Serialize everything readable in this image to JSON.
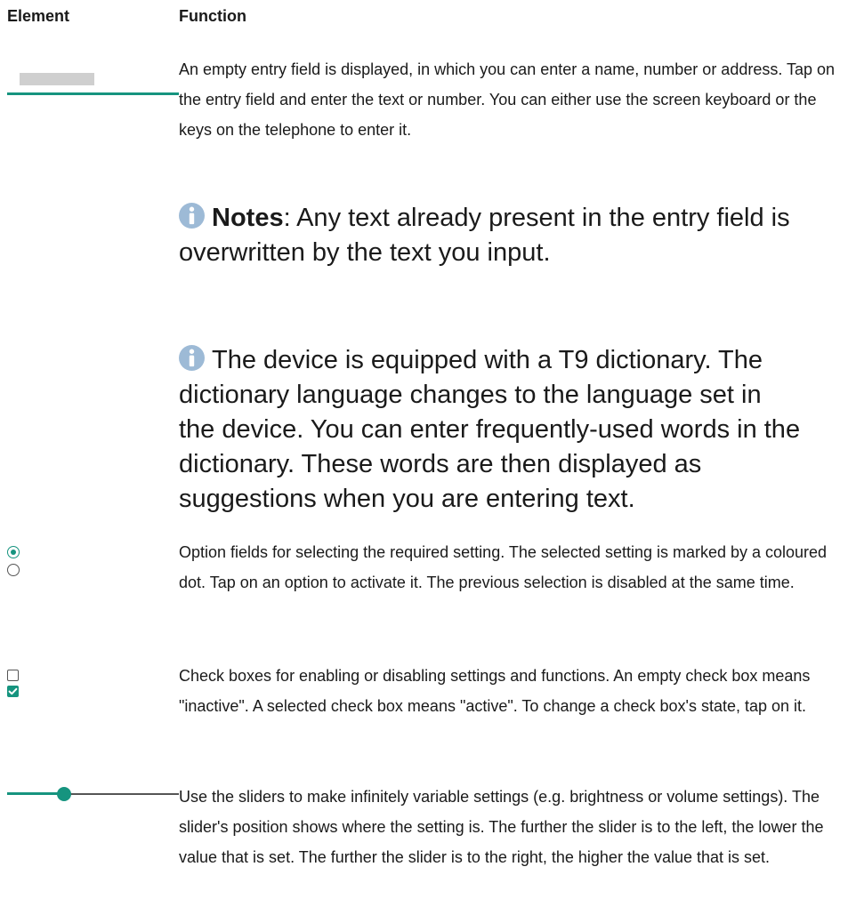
{
  "headers": {
    "element": "Element",
    "function": "Function"
  },
  "colors": {
    "accent": "#16947f",
    "field_fill": "#cfcfcf",
    "track": "#555555",
    "note_icon": "#9dbad6"
  },
  "rows": {
    "entry_field": {
      "description": "An empty entry field is displayed, in which you can enter a name, number or address. Tap on the entry field and enter the text or number. You can either use the screen keyboard or the keys on the telephone to enter it.",
      "notes": [
        {
          "icon": "info-icon",
          "label": "Notes",
          "text": ": Any text already present in the entry field is overwritten by the text you input."
        },
        {
          "icon": "info-icon",
          "text": "The device is equipped with a T9 dictionary. The dictionary language changes to the language set in the device. You can enter frequently-used words in the dictionary. These words are then displayed as suggestions when you are entering text."
        }
      ]
    },
    "option_fields": {
      "description": "Option fields for selecting the required setting. The selected setting is marked by a coloured dot. Tap on an option to activate it. The previous selection is disabled at the same time.",
      "options": [
        {
          "selected": true
        },
        {
          "selected": false
        }
      ]
    },
    "check_boxes": {
      "description": "Check boxes for enabling or disabling settings and functions. An empty check box means \"inactive\". A selected check box means \"active\". To change a check box's state, tap on it.",
      "boxes": [
        {
          "checked": false
        },
        {
          "checked": true
        }
      ]
    },
    "slider": {
      "description": "Use the sliders to make infinitely variable settings (e.g. brightness or volume settings). The slider's position shows where the setting is. The further the slider is to the left, the lower the value that is set. The further the slider is to the right, the higher the value that is set.",
      "value_fraction": 0.33
    }
  }
}
